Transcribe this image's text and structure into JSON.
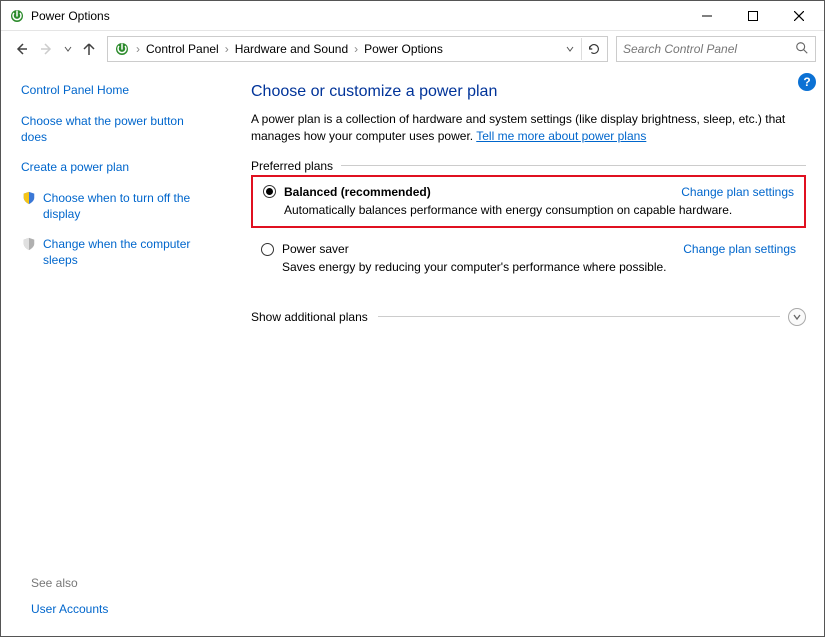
{
  "window": {
    "title": "Power Options"
  },
  "breadcrumb": {
    "items": [
      "Control Panel",
      "Hardware and Sound",
      "Power Options"
    ]
  },
  "search": {
    "placeholder": "Search Control Panel"
  },
  "sidebar": {
    "home": "Control Panel Home",
    "links": [
      {
        "label": "Choose what the power button does",
        "icon": null
      },
      {
        "label": "Create a power plan",
        "icon": null
      },
      {
        "label": "Choose when to turn off the display",
        "icon": "shield"
      },
      {
        "label": "Change when the computer sleeps",
        "icon": "shield"
      }
    ],
    "see_also_label": "See also",
    "see_also_links": [
      "User Accounts"
    ]
  },
  "main": {
    "heading": "Choose or customize a power plan",
    "description_prefix": "A power plan is a collection of hardware and system settings (like display brightness, sleep, etc.) that manages how your computer uses power. ",
    "description_link": "Tell me more about power plans",
    "preferred_label": "Preferred plans",
    "plans": [
      {
        "name": "Balanced (recommended)",
        "desc": "Automatically balances performance with energy consumption on capable hardware.",
        "selected": true,
        "change_label": "Change plan settings",
        "highlighted": true
      },
      {
        "name": "Power saver",
        "desc": "Saves energy by reducing your computer's performance where possible.",
        "selected": false,
        "change_label": "Change plan settings",
        "highlighted": false
      }
    ],
    "show_additional_label": "Show additional plans"
  }
}
